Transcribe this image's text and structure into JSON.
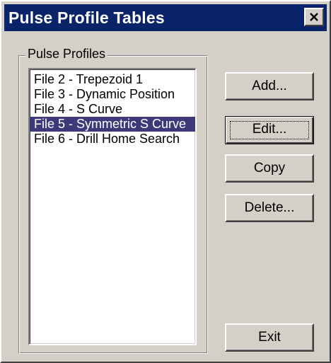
{
  "window": {
    "title": "Pulse Profile Tables"
  },
  "group": {
    "label": "Pulse Profiles"
  },
  "list": {
    "items": [
      {
        "label": "File 2 - Trepezoid 1",
        "selected": false
      },
      {
        "label": "File 3 - Dynamic Position",
        "selected": false
      },
      {
        "label": "File 4 - S Curve",
        "selected": false
      },
      {
        "label": "File 5 - Symmetric S Curve",
        "selected": true
      },
      {
        "label": "File 6 - Drill Home Search",
        "selected": false
      }
    ]
  },
  "buttons": {
    "add": "Add...",
    "edit": "Edit...",
    "copy": "Copy",
    "delete": "Delete...",
    "exit": "Exit"
  },
  "colors": {
    "titlebar": "#0a246a",
    "selection": "#3e3a7a",
    "face": "#d4d0c8"
  },
  "icons": {
    "close": "close-icon"
  }
}
